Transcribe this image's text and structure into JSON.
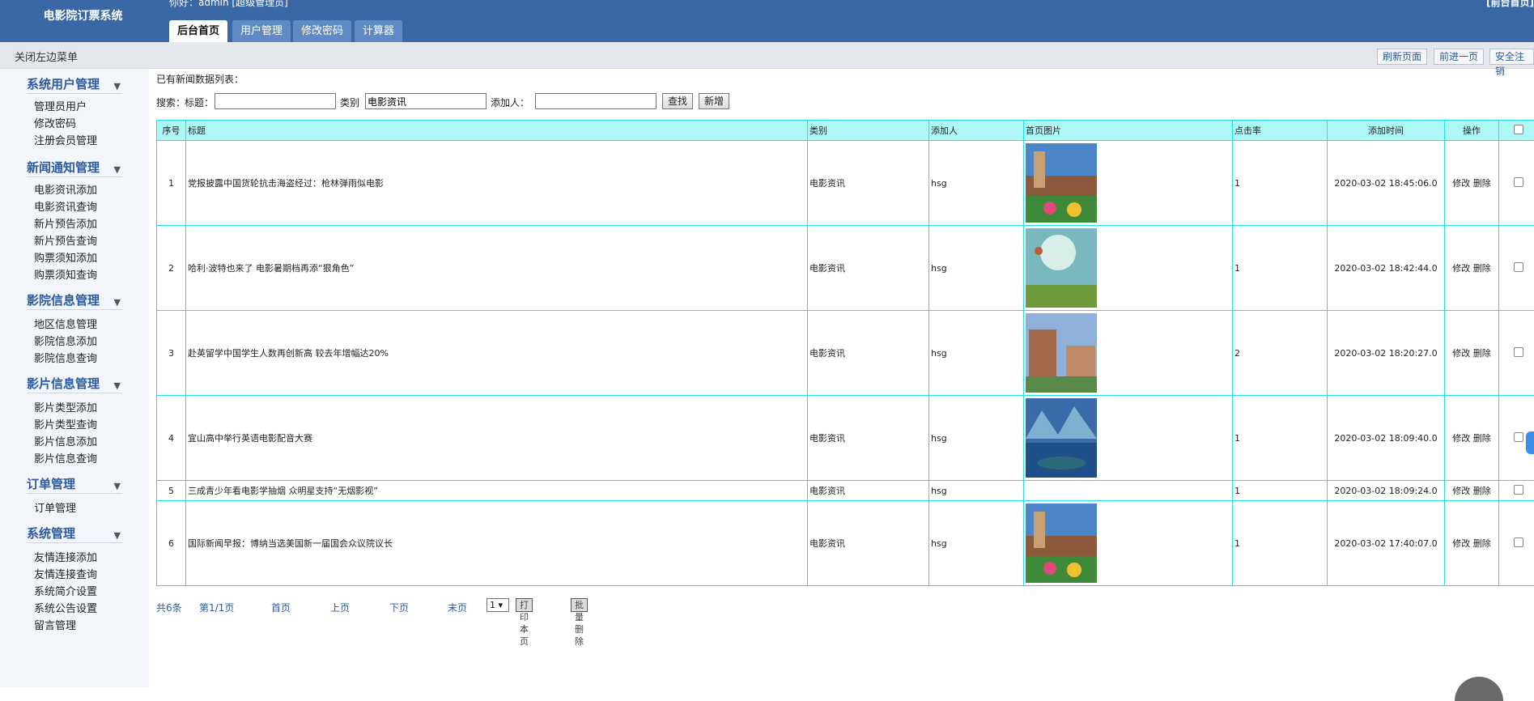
{
  "header": {
    "logo": "电影院订票系统",
    "greeting": "你好：admin [超级管理员]",
    "home_link": "[前台首页]",
    "tabs": [
      {
        "label": "后台首页",
        "active": true
      },
      {
        "label": "用户管理",
        "active": false
      },
      {
        "label": "修改密码",
        "active": false
      },
      {
        "label": "计算器",
        "active": false
      }
    ]
  },
  "subbar": {
    "close_menu": "关闭左边菜单",
    "refresh": "刷新页面",
    "forward": "前进一页",
    "logout": "安全注销"
  },
  "sidebar": {
    "groups": [
      {
        "title": "系统用户管理",
        "items": [
          "管理员用户",
          "修改密码",
          "注册会员管理"
        ]
      },
      {
        "title": "新闻通知管理",
        "items": [
          "电影资讯添加",
          "电影资讯查询",
          "新片预告添加",
          "新片预告查询",
          "购票须知添加",
          "购票须知查询"
        ]
      },
      {
        "title": "影院信息管理",
        "items": [
          "地区信息管理",
          "影院信息添加",
          "影院信息查询"
        ]
      },
      {
        "title": "影片信息管理",
        "items": [
          "影片类型添加",
          "影片类型查询",
          "影片信息添加",
          "影片信息查询"
        ]
      },
      {
        "title": "订单管理",
        "items": [
          "订单管理"
        ]
      },
      {
        "title": "系统管理",
        "items": [
          "友情连接添加",
          "友情连接查询",
          "系统简介设置",
          "系统公告设置",
          "留言管理"
        ]
      }
    ]
  },
  "main": {
    "list_title": "已有新闻数据列表：",
    "search": {
      "label": "搜索：",
      "title_label": "标题：",
      "title_value": "",
      "category_label": "类别",
      "category_value": "电影资讯",
      "adder_label": "添加人：",
      "adder_value": "",
      "search_button": "查找",
      "add_button": "新增"
    },
    "table": {
      "headers": [
        "序号",
        "标题",
        "类别",
        "添加人",
        "首页图片",
        "点击率",
        "添加时间",
        "操作"
      ],
      "edit_label": "修改",
      "delete_label": "删除",
      "rows": [
        {
          "no": "1",
          "title": "党报披露中国货轮抗击海盗经过：枪林弹雨似电影",
          "category": "电影资讯",
          "adder": "hsg",
          "image": "windmill",
          "clicks": "1",
          "time": "2020-03-02 18:45:06.0"
        },
        {
          "no": "2",
          "title": "哈利·波特也来了 电影暑期档再添“狠角色”",
          "category": "电影资讯",
          "adder": "hsg",
          "image": "balloon",
          "clicks": "1",
          "time": "2020-03-02 18:42:44.0"
        },
        {
          "no": "3",
          "title": "赴英留学中国学生人数再创新高 较去年增幅达20%",
          "category": "电影资讯",
          "adder": "hsg",
          "image": "campus",
          "clicks": "2",
          "time": "2020-03-02 18:20:27.0"
        },
        {
          "no": "4",
          "title": "宜山高中举行英语电影配音大赛",
          "category": "电影资讯",
          "adder": "hsg",
          "image": "lake",
          "clicks": "1",
          "time": "2020-03-02 18:09:40.0"
        },
        {
          "no": "5",
          "title": "三成青少年看电影学抽烟 众明星支持“无烟影视”",
          "category": "电影资讯",
          "adder": "hsg",
          "image": "",
          "clicks": "1",
          "time": "2020-03-02 18:09:24.0"
        },
        {
          "no": "6",
          "title": "国际新闻早报：博纳当选美国新一届国会众议院议长",
          "category": "电影资讯",
          "adder": "hsg",
          "image": "windmill",
          "clicks": "1",
          "time": "2020-03-02 17:40:07.0"
        }
      ]
    },
    "pager": {
      "total": "共6条",
      "page_info": "第1/1页",
      "first": "首页",
      "prev": "上页",
      "next": "下页",
      "last": "末页",
      "page_select": "1",
      "print_button": "打印本页",
      "batch_delete_button": "批量删除"
    }
  },
  "colors": {
    "header_bg": "#3a67a6",
    "table_border": "#23e0e6",
    "table_header_bg": "#aef7f7",
    "link": "#2c5aa0"
  }
}
